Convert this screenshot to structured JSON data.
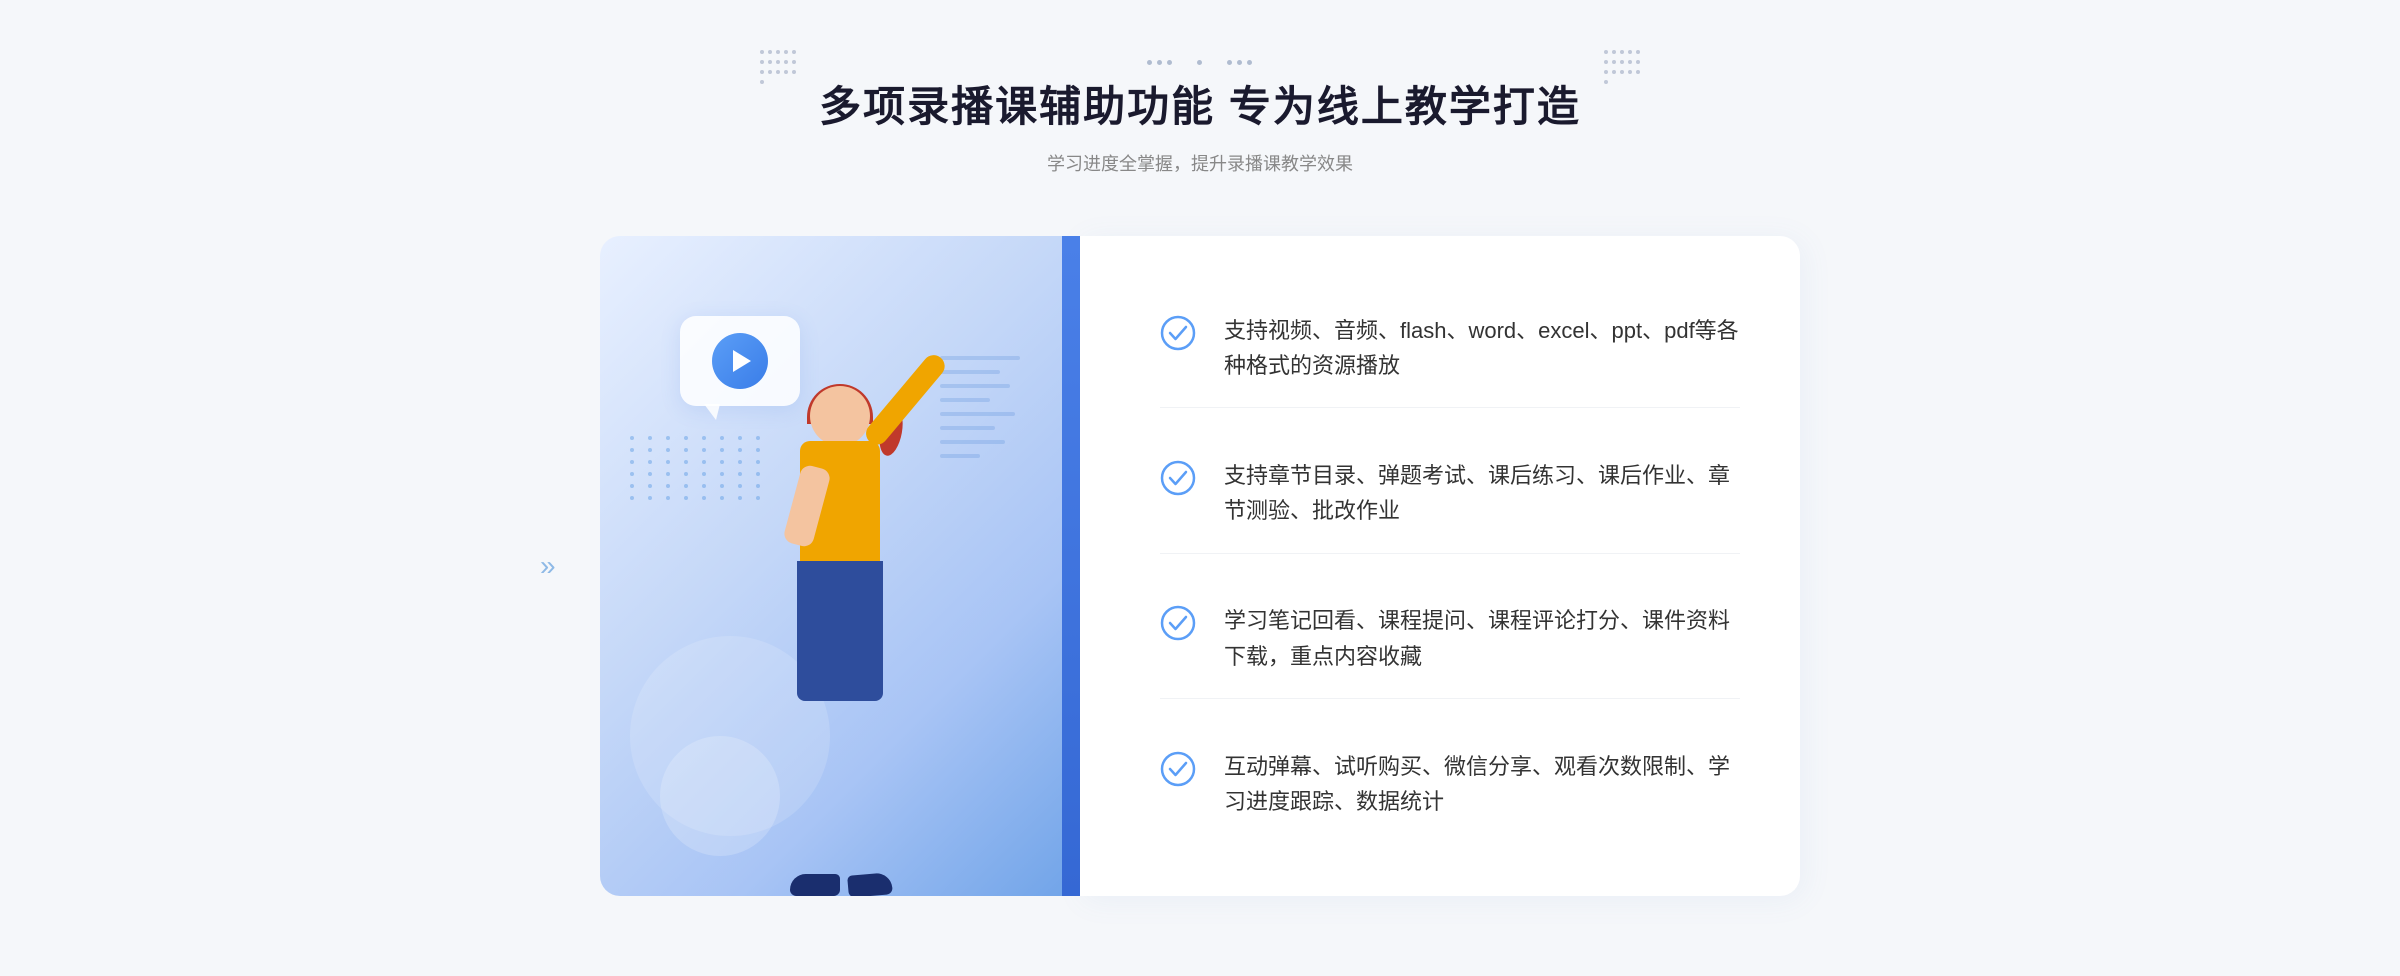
{
  "header": {
    "dots_left": "decorative",
    "dots_right": "decorative",
    "main_title": "多项录播课辅助功能 专为线上教学打造",
    "subtitle": "学习进度全掌握，提升录播课教学效果"
  },
  "features": [
    {
      "id": "feature-1",
      "text": "支持视频、音频、flash、word、excel、ppt、pdf等各种格式的资源播放"
    },
    {
      "id": "feature-2",
      "text": "支持章节目录、弹题考试、课后练习、课后作业、章节测验、批改作业"
    },
    {
      "id": "feature-3",
      "text": "学习笔记回看、课程提问、课程评论打分、课件资料下载，重点内容收藏"
    },
    {
      "id": "feature-4",
      "text": "互动弹幕、试听购买、微信分享、观看次数限制、学习进度跟踪、数据统计"
    }
  ],
  "colors": {
    "accent_blue": "#4a80e8",
    "check_circle": "#5b9ef7",
    "title_color": "#1a1a2e",
    "text_color": "#333333",
    "subtitle_color": "#888888"
  },
  "icons": {
    "check": "check-circle-icon",
    "play": "play-icon",
    "arrows": "double-chevron-right-icon"
  }
}
